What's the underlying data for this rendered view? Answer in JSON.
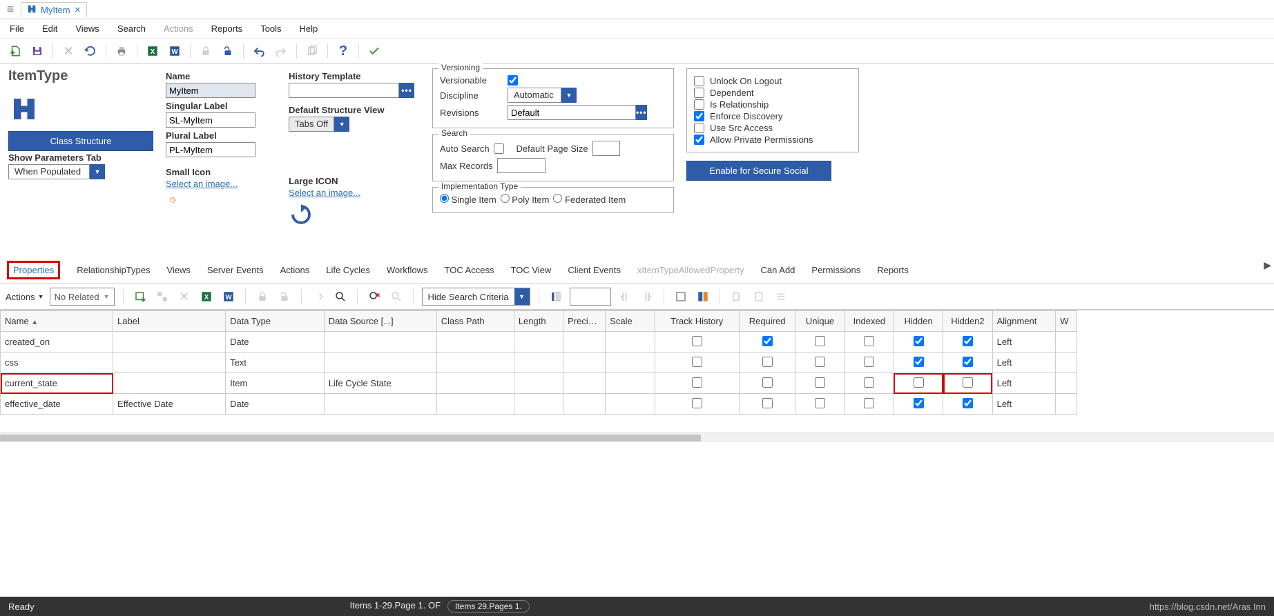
{
  "tab": {
    "title": "MyItem"
  },
  "menu": {
    "file": "File",
    "edit": "Edit",
    "views": "Views",
    "search": "Search",
    "actions": "Actions",
    "reports": "Reports",
    "tools": "Tools",
    "help": "Help"
  },
  "form": {
    "title": "ItemType",
    "class_structure_btn": "Class Structure",
    "show_params_label": "Show Parameters Tab",
    "show_params_value": "When Populated",
    "name_label": "Name",
    "name_value": "MyItem",
    "singular_label": "Singular Label",
    "singular_value": "SL-MyItem",
    "plural_label": "Plural Label",
    "plural_value": "PL-MyItem",
    "small_icon_label": "Small Icon",
    "select_image": "Select an image...",
    "history_label": "History Template",
    "default_struct_label": "Default Structure View",
    "default_struct_value": "Tabs Off",
    "large_icon_label": "Large ICON",
    "versioning": {
      "legend": "Versioning",
      "versionable": "Versionable",
      "versionable_checked": true,
      "discipline": "Discipline",
      "discipline_value": "Automatic",
      "revisions": "Revisions",
      "revisions_value": "Default"
    },
    "search": {
      "legend": "Search",
      "auto_search": "Auto Search",
      "default_page_size": "Default Page Size",
      "max_records": "Max Records"
    },
    "impl": {
      "legend": "Implementation Type",
      "single": "Single Item",
      "poly": "Poly Item",
      "federated": "Federated Item",
      "selected": "single"
    },
    "options": {
      "unlock": "Unlock On Logout",
      "unlock_c": false,
      "dependent": "Dependent",
      "dependent_c": false,
      "is_rel": "Is Relationship",
      "is_rel_c": false,
      "enforce": "Enforce Discovery",
      "enforce_c": true,
      "use_src": "Use Src Access",
      "use_src_c": false,
      "allow_priv": "Allow Private Permissions",
      "allow_priv_c": true
    },
    "secure_social_btn": "Enable for Secure Social"
  },
  "reltabs": [
    "Properties",
    "RelationshipTypes",
    "Views",
    "Server Events",
    "Actions",
    "Life Cycles",
    "Workflows",
    "TOC Access",
    "TOC View",
    "Client Events",
    "xItemTypeAllowedProperty",
    "Can Add",
    "Permissions",
    "Reports"
  ],
  "reltoolbar": {
    "actions": "Actions",
    "no_related": "No Related",
    "hide_search": "Hide Search Criteria"
  },
  "grid": {
    "cols": [
      "Name",
      "Label",
      "Data Type",
      "Data Source [...]",
      "Class Path",
      "Length",
      "Preci…",
      "Scale",
      "Track History",
      "Required",
      "Unique",
      "Indexed",
      "Hidden",
      "Hidden2",
      "Alignment",
      "W"
    ],
    "rows": [
      {
        "name": "created_on",
        "label": "",
        "dtype": "Date",
        "dsrc": "",
        "cpath": "",
        "len": "",
        "prec": "",
        "scale": "",
        "track": false,
        "req": true,
        "uniq": false,
        "idx": false,
        "hid": true,
        "hid2": true,
        "align": "Left",
        "hl": false,
        "hlcols": false
      },
      {
        "name": "css",
        "label": "",
        "dtype": "Text",
        "dsrc": "",
        "cpath": "",
        "len": "",
        "prec": "",
        "scale": "",
        "track": false,
        "req": false,
        "uniq": false,
        "idx": false,
        "hid": true,
        "hid2": true,
        "align": "Left",
        "hl": false,
        "hlcols": false
      },
      {
        "name": "current_state",
        "label": "",
        "dtype": "Item",
        "dsrc": "Life Cycle State",
        "cpath": "",
        "len": "",
        "prec": "",
        "scale": "",
        "track": false,
        "req": false,
        "uniq": false,
        "idx": false,
        "hid": false,
        "hid2": false,
        "align": "Left",
        "hl": true,
        "hlcols": true
      },
      {
        "name": "effective_date",
        "label": "Effective Date",
        "dtype": "Date",
        "dsrc": "",
        "cpath": "",
        "len": "",
        "prec": "",
        "scale": "",
        "track": false,
        "req": false,
        "uniq": false,
        "idx": false,
        "hid": true,
        "hid2": true,
        "align": "Left",
        "hl": false,
        "hlcols": false
      }
    ]
  },
  "status": {
    "ready": "Ready",
    "range": "Items 1-29.Page 1. OF",
    "count": "Items 29.Pages 1.",
    "url": "https://blog.csdn.net/",
    "brand": "Aras Inn"
  }
}
